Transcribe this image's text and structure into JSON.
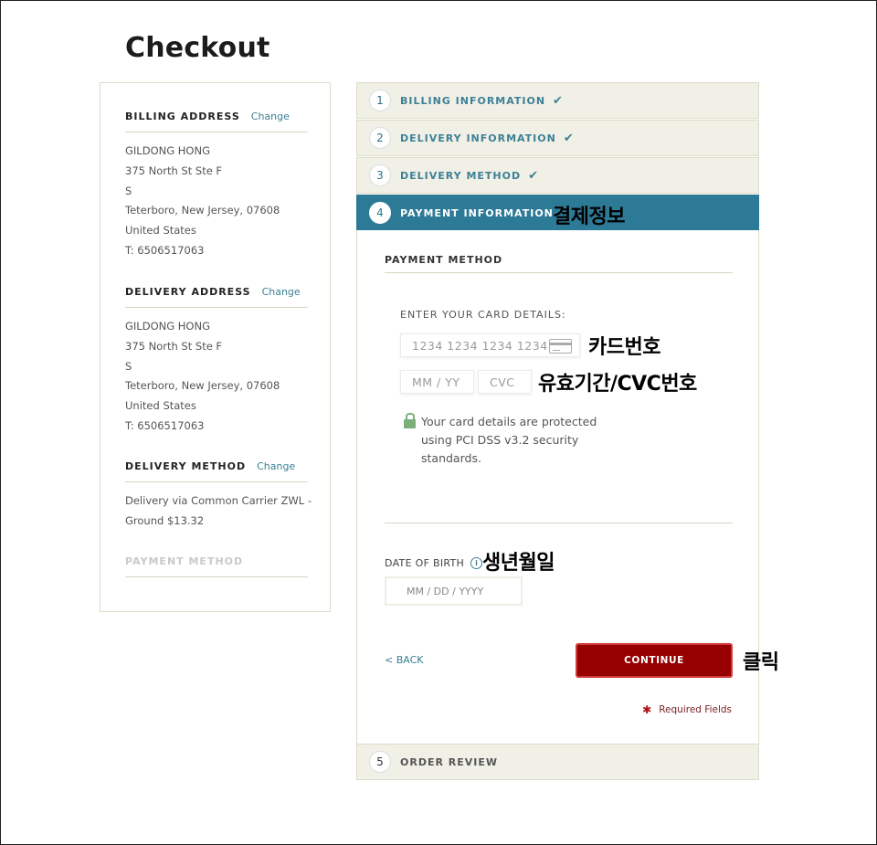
{
  "page": {
    "title": "Checkout"
  },
  "summary": {
    "billing": {
      "title": "BILLING ADDRESS",
      "change": "Change",
      "lines": [
        "GILDONG HONG",
        "375 North St Ste F",
        "S",
        "Teterboro, New Jersey, 07608",
        "United States",
        "T: 6506517063"
      ]
    },
    "delivery": {
      "title": "DELIVERY ADDRESS",
      "change": "Change",
      "lines": [
        "GILDONG HONG",
        "375 North St Ste F",
        "S",
        "Teterboro, New Jersey, 07608",
        "United States",
        "T: 6506517063"
      ]
    },
    "method": {
      "title": "DELIVERY METHOD",
      "change": "Change",
      "lines": [
        "Delivery via Common Carrier ZWL -",
        "Ground $13.32"
      ]
    },
    "payment": {
      "title": "PAYMENT METHOD"
    }
  },
  "steps": [
    {
      "num": "1",
      "label": "BILLING INFORMATION",
      "check": "✔"
    },
    {
      "num": "2",
      "label": "DELIVERY INFORMATION",
      "check": "✔"
    },
    {
      "num": "3",
      "label": "DELIVERY METHOD",
      "check": "✔"
    },
    {
      "num": "4",
      "label": "PAYMENT INFORMATION"
    },
    {
      "num": "5",
      "label": "ORDER REVIEW"
    }
  ],
  "payment": {
    "method_title": "PAYMENT METHOD",
    "card_label": "ENTER YOUR CARD DETAILS:",
    "card_number_placeholder": "1234 1234 1234 1234",
    "expiry_placeholder": "MM / YY",
    "cvc_placeholder": "CVC",
    "secure_text": "Your card details are protected using PCI DSS v3.2 security standards.",
    "dob_label": "DATE OF BIRTH",
    "dob_placeholder": "MM / DD / YYYY",
    "back": "< BACK",
    "continue": "CONTINUE",
    "required": "Required Fields",
    "required_mark": "✱"
  },
  "annotations": {
    "payment_info": "결제정보",
    "card_number": "카드번호",
    "expiry_cvc": "유효기간/CVC번호",
    "dob": "생년월일",
    "click": "클릭"
  },
  "colors": {
    "accent": "#2d7a97",
    "button": "#970000",
    "step_bg": "#f1f0e7",
    "secure_icon": "#7bb07b"
  }
}
